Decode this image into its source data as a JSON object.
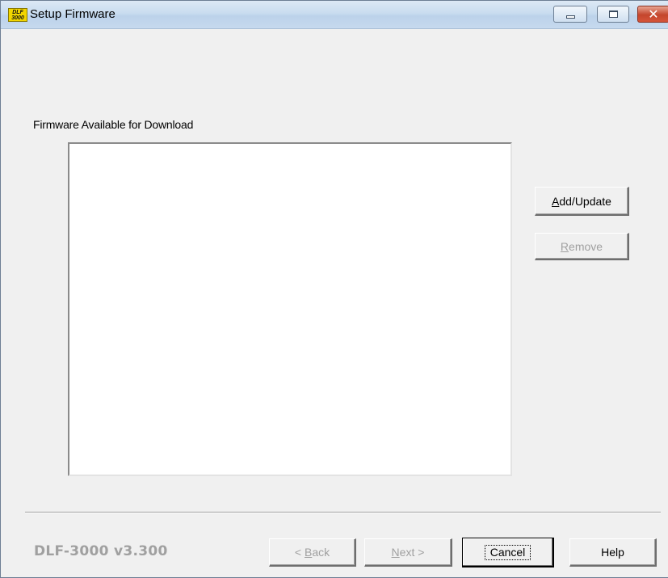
{
  "window": {
    "title": "Setup Firmware",
    "icon": {
      "name": "dlf3000-app-icon",
      "line1": "DLF",
      "line2": "3000",
      "color": "#f2d600"
    },
    "controls": {
      "minimize": "minimize-icon",
      "maximize": "maximize-icon",
      "close": "close-icon",
      "close_glyph": "✕"
    }
  },
  "firmware_list": {
    "label": "Firmware Available for Download",
    "items": []
  },
  "side_buttons": {
    "add_update": {
      "mnemonic": "A",
      "rest": "dd/Update"
    },
    "remove": {
      "mnemonic": "R",
      "rest": "emove",
      "disabled": true
    }
  },
  "footer": {
    "version": "DLF-3000 v3.300",
    "back": {
      "prefix": "< ",
      "mnemonic": "B",
      "rest": "ack",
      "disabled": true
    },
    "next": {
      "mnemonic": "N",
      "rest": "ext",
      "suffix": " >",
      "disabled": true
    },
    "cancel": "Cancel",
    "help": "Help"
  },
  "colors": {
    "dialog_bg": "#f0f0f0",
    "titlebar": "#c9dcef",
    "close_button": "#c4452c",
    "disabled_text": "#a0a0a0"
  }
}
